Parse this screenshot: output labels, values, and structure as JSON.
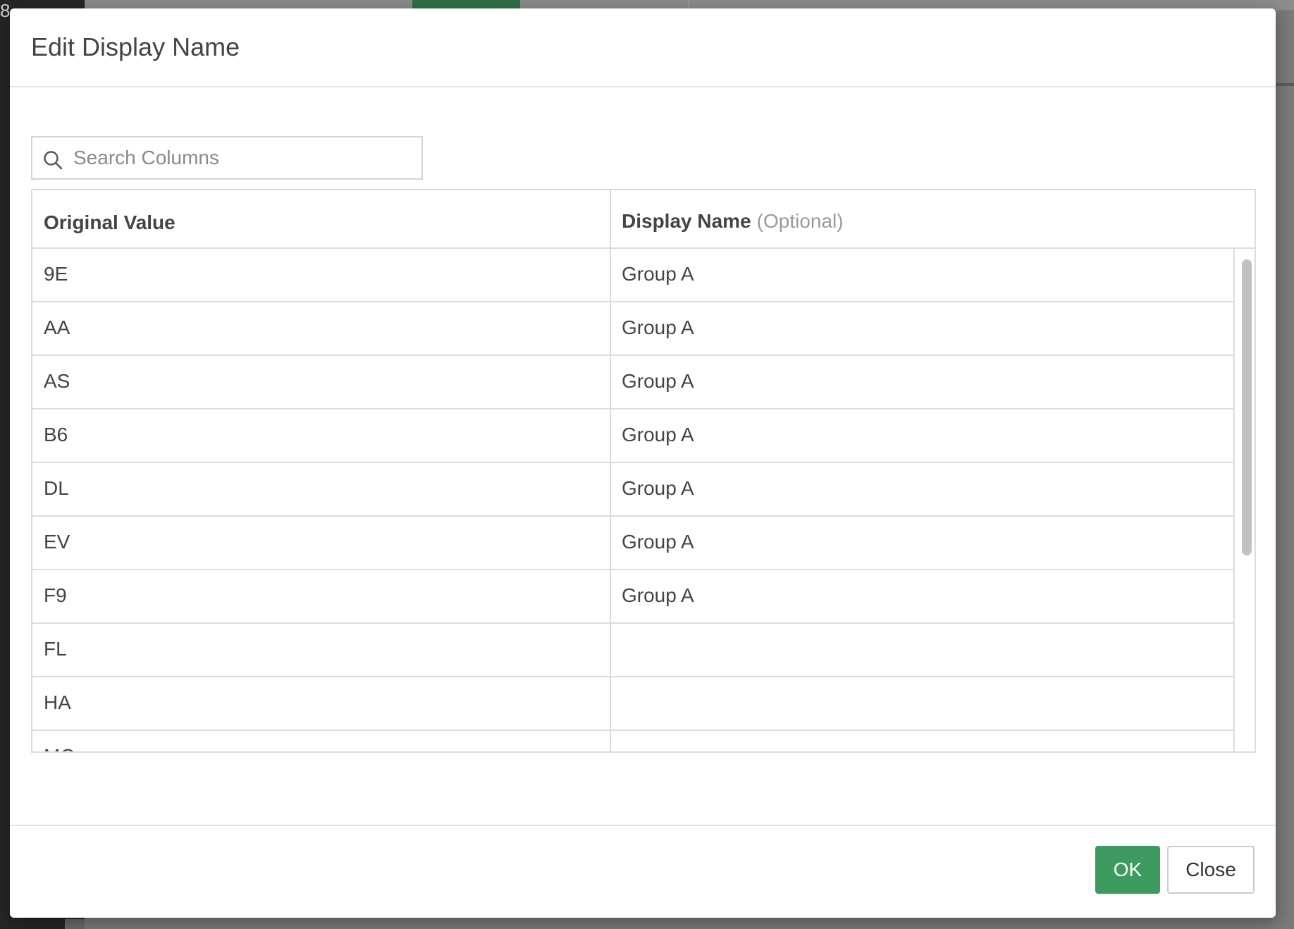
{
  "dialog": {
    "title": "Edit Display Name"
  },
  "search": {
    "placeholder": "Search Columns",
    "value": ""
  },
  "table": {
    "headers": {
      "original": "Original Value",
      "display": "Display Name",
      "display_hint": "(Optional)"
    },
    "rows": [
      {
        "original": "9E",
        "display": "Group A"
      },
      {
        "original": "AA",
        "display": "Group A"
      },
      {
        "original": "AS",
        "display": "Group A"
      },
      {
        "original": "B6",
        "display": "Group A"
      },
      {
        "original": "DL",
        "display": "Group A"
      },
      {
        "original": "EV",
        "display": "Group A"
      },
      {
        "original": "F9",
        "display": "Group A"
      },
      {
        "original": "FL",
        "display": ""
      },
      {
        "original": "HA",
        "display": ""
      },
      {
        "original": "MQ",
        "display": ""
      }
    ]
  },
  "footer": {
    "ok_label": "OK",
    "close_label": "Close"
  },
  "colors": {
    "primary_button": "#3e9b5f",
    "text": "#444444",
    "border": "#dcdcdc"
  },
  "background": {
    "left_edge_text": "8"
  }
}
